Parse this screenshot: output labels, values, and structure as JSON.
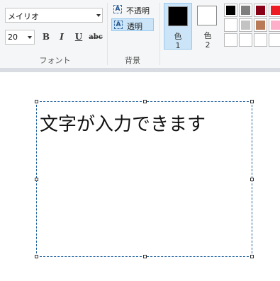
{
  "font_group": {
    "font_name": "メイリオ",
    "font_size": "20",
    "bold_label": "B",
    "italic_label": "I",
    "underline_label": "U",
    "strikethrough_label": "abc",
    "group_label": "フォント"
  },
  "background_group": {
    "opaque_label": "不透明",
    "transparent_label": "透明",
    "selected": "transparent",
    "group_label": "背景"
  },
  "colors_group": {
    "color1": {
      "label_top": "色",
      "label_bottom": "1",
      "value": "#000000"
    },
    "color2": {
      "label_top": "色",
      "label_bottom": "2",
      "value": "#ffffff"
    },
    "palette": [
      [
        "#000000",
        "#7f7f7f",
        "#880015",
        "#ed1c24"
      ],
      [
        "#ffffff",
        "#c3c3c3",
        "#b97a57",
        "#ffaec9"
      ],
      [
        "#ffffff",
        "#ffffff",
        "#ffffff",
        "#ffffff"
      ]
    ]
  },
  "canvas": {
    "text": "文字が入力できます"
  }
}
